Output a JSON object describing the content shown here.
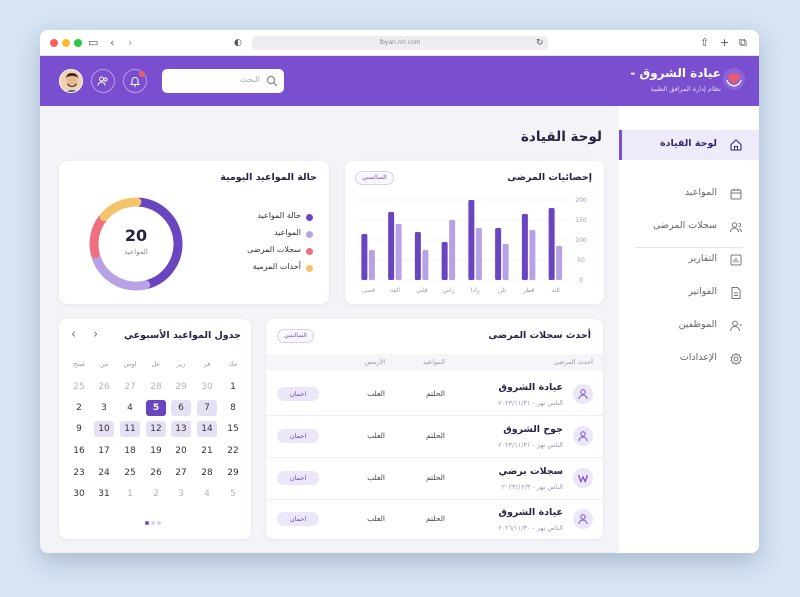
{
  "browser": {
    "url": "lbyan.nrl.com"
  },
  "header": {
    "brand_title": "عيادة الشروق -",
    "brand_subtitle": "نظام إدارة المرافق الطبية",
    "search_placeholder": "البحث"
  },
  "sidebar": {
    "items": [
      {
        "label": "لوحة القيادة",
        "icon": "home-icon",
        "active": true
      },
      {
        "label": "المواعيد",
        "icon": "calendar-icon"
      },
      {
        "label": "سجلات المرضى",
        "icon": "users-icon"
      },
      {
        "label": "التقارير",
        "icon": "chart-icon"
      },
      {
        "label": "الفواتير",
        "icon": "document-icon"
      },
      {
        "label": "الموظفين",
        "icon": "user-icon"
      },
      {
        "label": "الإعدادات",
        "icon": "gear-icon"
      }
    ]
  },
  "page": {
    "title": "لوحة القيادة"
  },
  "stats": {
    "title": "إحصائيات المرضى",
    "badge": "السالسبي",
    "chart_data": {
      "type": "bar",
      "categories": [
        "الثد",
        "قطر",
        "تلن",
        "زادا",
        "زاس",
        "قلتي",
        "الفد",
        "قصي"
      ],
      "series": [
        {
          "values": [
            180,
            165,
            130,
            200,
            95,
            120,
            170,
            115
          ]
        },
        {
          "values": [
            85,
            125,
            90,
            130,
            150,
            75,
            140,
            75
          ]
        }
      ],
      "ylim": [
        0,
        200
      ],
      "yticks": [
        0,
        50,
        100,
        150,
        200
      ],
      "colors": [
        "#6a45c0",
        "#b7a2e6"
      ]
    }
  },
  "status": {
    "title": "حالة المواعيد اليومية",
    "center_value": "20",
    "center_label": "المواعيد",
    "chart_data": {
      "type": "pie",
      "labels": [
        "حالة المواعيد",
        "المواعيد",
        "سجلات المرضى",
        "أحدات المرمية"
      ],
      "values": [
        45,
        25,
        15,
        15
      ],
      "colors": [
        "#6a45c0",
        "#b7a2e6",
        "#ee7080",
        "#f5c36b"
      ]
    }
  },
  "calendar": {
    "title": "جدول المواعيد الأسبوعي",
    "weekdays": [
      "حك",
      "قر",
      "زبر",
      "عل",
      "اوس",
      "من",
      "صنح"
    ],
    "weeks": [
      [
        "1",
        "30",
        "29",
        "28",
        "27",
        "26",
        "25"
      ],
      [
        "8",
        "7",
        "6",
        "5",
        "4",
        "3",
        "2"
      ],
      [
        "15",
        "14",
        "13",
        "12",
        "11",
        "10",
        "9"
      ],
      [
        "22",
        "21",
        "20",
        "19",
        "18",
        "17",
        "16"
      ],
      [
        "29",
        "28",
        "27",
        "26",
        "25",
        "24",
        "23"
      ],
      [
        "5",
        "4",
        "3",
        "2",
        "1",
        "31",
        "30"
      ]
    ]
  },
  "records": {
    "title": "أحدث سجلات المرضى",
    "badge": "السالنتبي",
    "columns": [
      "أحدث المرضى",
      "المواعيد",
      "الأرمس"
    ],
    "rows": [
      {
        "name": "عيادة الشروق",
        "date": "الناس تهر - ٢٠٢٣/١١/٣١",
        "appt": "الحلتم",
        "type": "العلب",
        "action": "احمان",
        "avatar": "user-icon"
      },
      {
        "name": "جوح الشروق",
        "date": "الناس تهر - ٢٠٢٣/١١/٣١",
        "appt": "الحلتم",
        "type": "العلب",
        "action": "احمان",
        "avatar": "user-icon"
      },
      {
        "name": "سجلات برضي",
        "date": "الناس تهر - ٢٠٢٣/١٢/٣",
        "appt": "الحلتم",
        "type": "العلب",
        "action": "احمان",
        "avatar": "w-icon"
      },
      {
        "name": "عيادة الشروق",
        "date": "الناس تهر - ٢٠٢٦/١١/٣٠",
        "appt": "الحلتم",
        "type": "العلب",
        "action": "احمان",
        "avatar": "user-icon"
      }
    ]
  }
}
